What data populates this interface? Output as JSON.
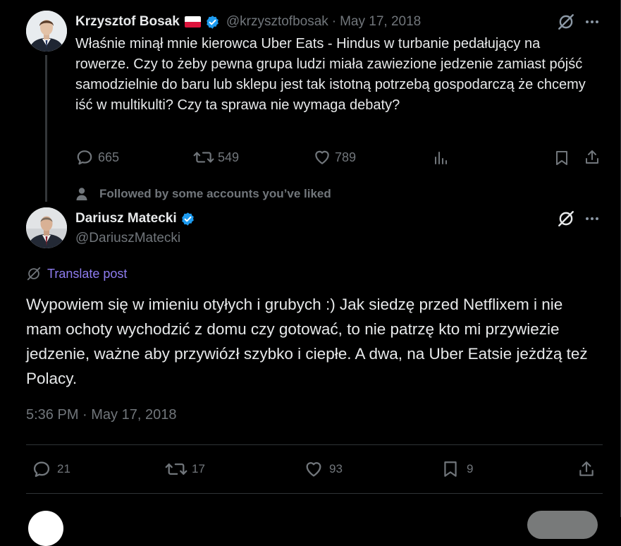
{
  "parent_tweet": {
    "author_name": "Krzysztof Bosak",
    "handle": "@krzysztofbosak",
    "date": "May 17, 2018",
    "separator": "·",
    "text": "Właśnie minął mnie kierowca Uber Eats - Hindus w turbanie pedałujący na rowerze. Czy to żeby pewna grupa ludzi miała zawiezione jedzenie zamiast pójść samodzielnie do baru lub sklepu jest tak istotną potrzebą gospodarczą że chcemy iść w multikulti? Czy ta sprawa nie wymaga debaty?",
    "replies": "665",
    "reposts": "549",
    "likes": "789"
  },
  "context_label": "Followed by some accounts you’ve liked",
  "main_tweet": {
    "author_name": "Dariusz Matecki",
    "handle": "@DariuszMatecki",
    "translate_label": "Translate post",
    "text": "Wypowiem się w imieniu otyłych i grubych :) Jak siedzę przed Netflixem i nie mam ochoty wychodzić z domu czy gotować, to nie patrzę kto mi przywiezie jedzenie, ważne aby przywiózł szybko i ciepłe. A dwa, na Uber Eatsie jeżdżą też Polacy.",
    "timestamp": "5:36 PM · May 17, 2018",
    "replies": "21",
    "reposts": "17",
    "likes": "93",
    "bookmarks": "9"
  },
  "colors": {
    "background": "#000000",
    "text": "#e7e9ea",
    "muted": "#71767b",
    "verified": "#1d9bf0",
    "link": "#8e7cf0",
    "divider": "#2f3336"
  }
}
